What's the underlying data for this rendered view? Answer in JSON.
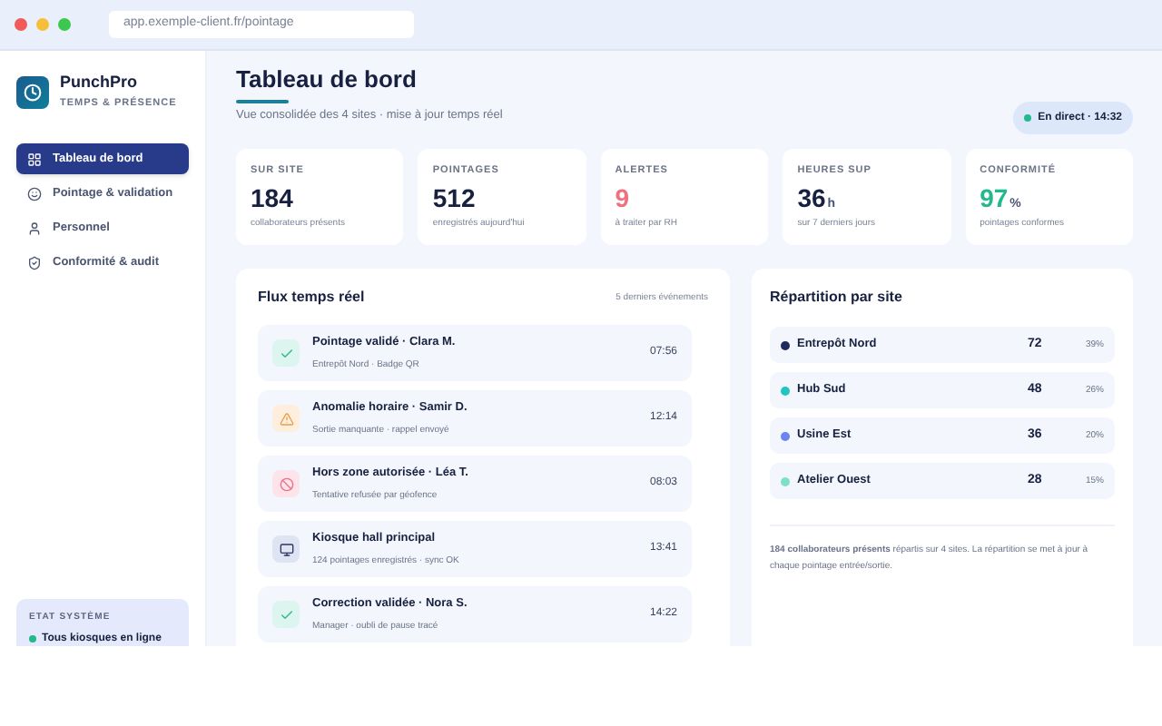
{
  "browser": {
    "url": "app.exemple-client.fr/pointage"
  },
  "brand": {
    "name": "PunchPro",
    "tagline": "TEMPS & PRÉSENCE"
  },
  "sidebar": {
    "items": [
      {
        "label": "Tableau de bord",
        "selected": true
      },
      {
        "label": "Pointage & validation",
        "selected": false
      },
      {
        "label": "Personnel",
        "selected": false
      },
      {
        "label": "Conformité & audit",
        "selected": false
      }
    ],
    "status": {
      "title": "ETAT SYSTÈME",
      "text": "Tous kiosques en ligne"
    }
  },
  "header": {
    "title": "Tableau de bord",
    "subtitle": "Vue consolidée des 4 sites · mise à jour temps réel",
    "live": "En direct · 14:32"
  },
  "stats": [
    {
      "label": "SUR SITE",
      "value": "184",
      "caption": "collaborateurs présents",
      "kind": "neutral"
    },
    {
      "label": "POINTAGES",
      "value": "512",
      "caption": "enregistrés aujourd'hui",
      "kind": "neutral"
    },
    {
      "label": "ALERTES",
      "value": "9",
      "caption": "à traiter par RH",
      "kind": "alert"
    },
    {
      "label": "HEURES SUP",
      "value": "36",
      "unit": "h",
      "caption": "sur 7 derniers jours",
      "kind": "neutral"
    },
    {
      "label": "CONFORMITÉ",
      "value": "97",
      "unit": "%",
      "caption": "pointages conformes",
      "kind": "good"
    }
  ],
  "feed": {
    "title": "Flux temps réel",
    "note": "5 derniers événements",
    "events": [
      {
        "kind": "ok",
        "title": "Pointage validé · Clara M.",
        "detail": "Entrepôt Nord · Badge QR",
        "time": "07:56"
      },
      {
        "kind": "warn",
        "title": "Anomalie horaire · Samir D.",
        "detail": "Sortie manquante · rappel envoyé",
        "time": "12:14"
      },
      {
        "kind": "denied",
        "title": "Hors zone autorisée · Léa T.",
        "detail": "Tentative refusée par géofence",
        "time": "08:03"
      },
      {
        "kind": "device",
        "title": "Kiosque hall principal",
        "detail": "124 pointages enregistrés · sync OK",
        "time": "13:41"
      },
      {
        "kind": "ok",
        "title": "Correction validée · Nora S.",
        "detail": "Manager · oubli de pause tracé",
        "time": "14:22"
      }
    ]
  },
  "sites": {
    "title": "Répartition par site",
    "rows": [
      {
        "name": "Entrepôt Nord",
        "count": "72",
        "share": "39%",
        "color": "#1e2a5e"
      },
      {
        "name": "Hub Sud",
        "count": "48",
        "share": "26%",
        "color": "#22c3c3"
      },
      {
        "name": "Usine Est",
        "count": "36",
        "share": "20%",
        "color": "#6b85f0"
      },
      {
        "name": "Atelier Ouest",
        "count": "28",
        "share": "15%",
        "color": "#7fe0c8"
      }
    ],
    "summary": "**184 collaborateurs présents** répartis sur 4 sites. La répartition se met à jour à chaque pointage entrée/sortie."
  }
}
